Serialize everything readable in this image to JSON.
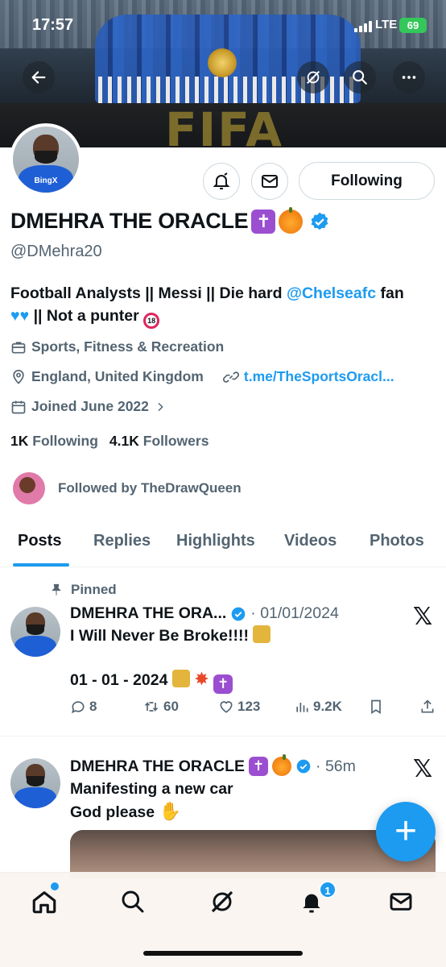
{
  "status_bar": {
    "time": "17:57",
    "network": "LTE",
    "battery": "69"
  },
  "banner": {
    "text": "FIFA"
  },
  "profile": {
    "display_name": "DMEHRA THE ORACLE",
    "handle": "@DMehra20",
    "following_button": "Following",
    "avatar_sponsor": "BingX",
    "bio": {
      "part1": "Football Analysts || Messi || Die hard ",
      "mention": "@Chelseafc",
      "part2": " fan",
      "line2": "|| Not a punter"
    },
    "category": "Sports, Fitness & Recreation",
    "location": "England, United Kingdom",
    "website": "t.me/TheSportsOracl...",
    "joined": "Joined June 2022",
    "following_count": "1K",
    "following_label": "Following",
    "followers_count": "4.1K",
    "followers_label": "Followers",
    "followed_by": "Followed by TheDrawQueen"
  },
  "tabs": [
    "Posts",
    "Replies",
    "Highlights",
    "Videos",
    "Photos"
  ],
  "tweets": [
    {
      "pinned_label": "Pinned",
      "author": "DMEHRA THE ORA...",
      "meta": "· 01/01/2024",
      "line1": "I Will Never Be Broke!!!!",
      "line2": "01 - 01 - 2024",
      "replies": "8",
      "retweets": "60",
      "likes": "123",
      "views": "9.2K"
    },
    {
      "author": "DMEHRA THE ORACLE",
      "meta": "· 56m",
      "line1": "Manifesting a new car",
      "line2": "God please"
    }
  ],
  "fab_label": "+",
  "notifications_badge": "1",
  "colors": {
    "accent": "#1d9bf0",
    "text": "#0f1419",
    "muted": "#536471"
  }
}
